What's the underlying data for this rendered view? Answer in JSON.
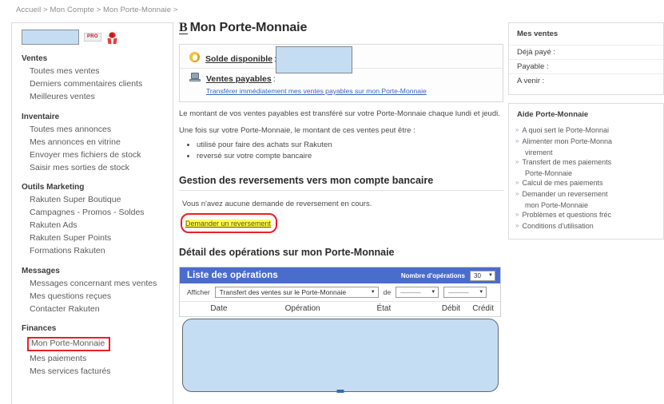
{
  "breadcrumb": "Accueil > Mon Compte > Mon Porte-Monnaie >",
  "shop": {
    "name_redacted": "",
    "pro_badge": "PRO",
    "rosette_icon": "award-rosette-icon"
  },
  "sidebar": {
    "groups": [
      {
        "title": "Ventes",
        "items": [
          "Toutes mes ventes",
          "Derniers commentaires clients",
          "Meilleures ventes"
        ]
      },
      {
        "title": "Inventaire",
        "items": [
          "Toutes mes annonces",
          "Mes annonces en vitrine",
          "Envoyer mes fichiers de stock",
          "Saisir mes sorties de stock"
        ]
      },
      {
        "title": "Outils Marketing",
        "items": [
          "Rakuten Super Boutique",
          "Campagnes - Promos - Soldes",
          "Rakuten Ads",
          "Rakuten Super Points",
          "Formations Rakuten"
        ]
      },
      {
        "title": "Messages",
        "items": [
          "Messages concernant mes ventes",
          "Mes questions reçues",
          "Contacter Rakuten"
        ]
      },
      {
        "title": "Finances",
        "items": [
          "Mon Porte-Monnaie",
          "Mes paiements",
          "Mes services facturés"
        ]
      }
    ],
    "highlighted_item": "Mon Porte-Monnaie",
    "highlight_color": "#ef1d25"
  },
  "main": {
    "title": "Mon Porte-Monnaie",
    "title_prefix_icon": "B",
    "balance": {
      "solde_label": "Solde disponible",
      "solde_colon": ":",
      "solde_icon": "gold-coin-icon",
      "ventes_label": "Ventes payables",
      "ventes_colon": ":",
      "ventes_icon": "laptop-icon",
      "transfer_link": "Transférer immédiatement mes ventes payables sur mon Porte-Monnaie",
      "redacted_amounts": ""
    },
    "paragraph_1": "Le montant de vos ventes payables est transféré sur votre Porte-Monnaie chaque lundi et jeudi.",
    "paragraph_2": "Une fois sur votre Porte-Monnaie, le montant de ces ventes peut être :",
    "bullets": [
      "utilisé pour faire des achats sur Rakuten",
      "reversé sur votre compte bancaire"
    ],
    "reversal_section_title": "Gestion des reversements vers mon compte bancaire",
    "reversal_note": "Vous n'avez aucune demande de reversement en cours.",
    "reversal_link": "Demander un reversement",
    "reversal_link_highlight": "#ffff4d",
    "detail_section_title": "Détail des opérations sur mon Porte-Monnaie"
  },
  "ops_table": {
    "header_title": "Liste des opérations",
    "header_bg": "#4a6dcc",
    "count_label": "Nombre d'opérations",
    "count_value": "30",
    "filters_label": "Afficher",
    "filter_type_value": "Transfert des ventes sur le Porte-Monnaie",
    "filter_de_label": "de",
    "filter_from_value": "———",
    "filter_to_value": "———",
    "columns": [
      "Date",
      "Opération",
      "État",
      "Débit",
      "Crédit"
    ],
    "rows_redacted": ""
  },
  "right": {
    "sales_panel": {
      "title": "Mes ventes",
      "rows": [
        "Déjà payé :",
        "Payable :",
        "A venir :"
      ]
    },
    "help_panel": {
      "title": "Aide Porte-Monnaie",
      "items": [
        {
          "line1": "A quoi sert le Porte-Monnai",
          "line2": ""
        },
        {
          "line1": "Alimenter mon Porte-Monna",
          "line2": "virement"
        },
        {
          "line1": "Transfert de mes paiements",
          "line2": "Porte-Monnaie"
        },
        {
          "line1": "Calcul de mes paiements",
          "line2": ""
        },
        {
          "line1": "Demander un reversement",
          "line2": "mon Porte-Monnaie"
        },
        {
          "line1": "Problèmes et questions fréc",
          "line2": ""
        },
        {
          "line1": "Conditions d'utilisation",
          "line2": ""
        }
      ],
      "bullet_glyph": "»"
    }
  }
}
